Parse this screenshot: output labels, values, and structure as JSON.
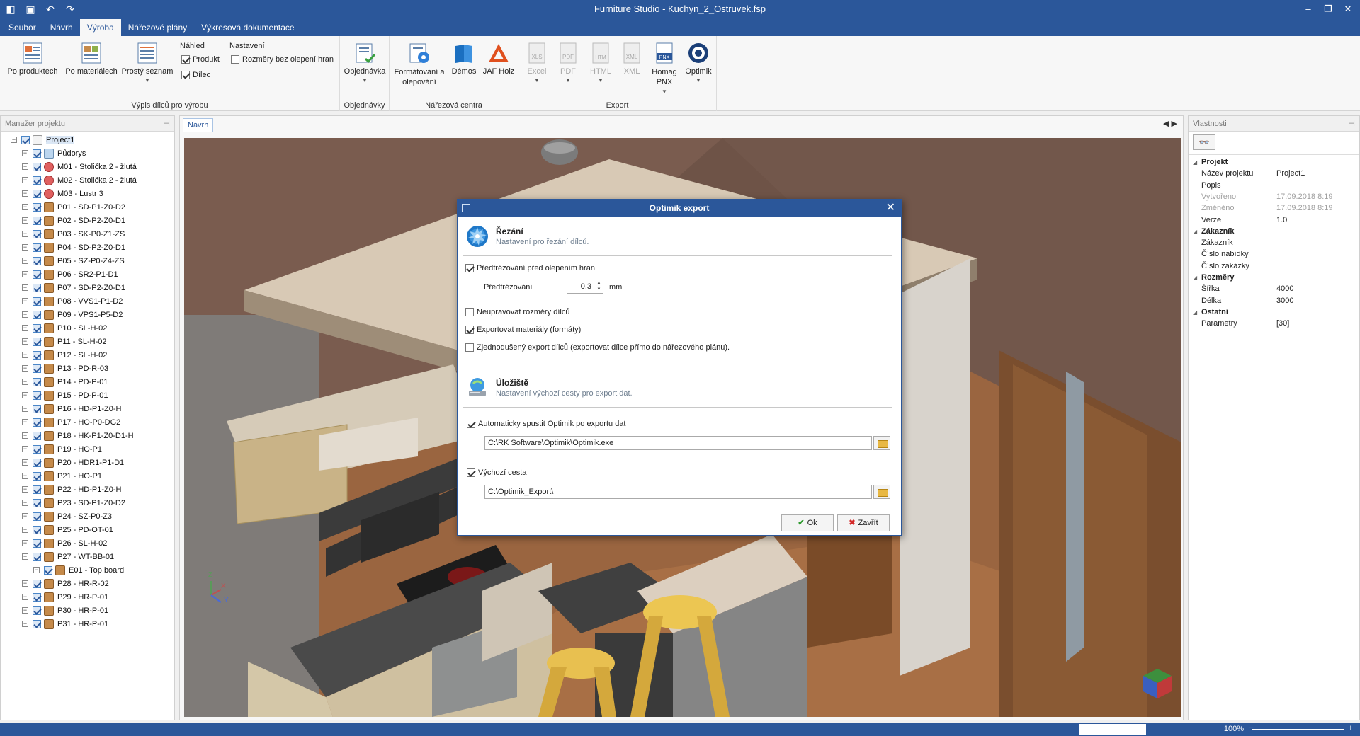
{
  "window": {
    "title": "Furniture Studio - Kuchyn_2_Ostruvek.fsp"
  },
  "menu": [
    "Soubor",
    "Návrh",
    "Výroba",
    "Nářezové plány",
    "Výkresová dokumentace"
  ],
  "ribbon": {
    "vypis": {
      "by_product": "Po produktech",
      "by_material": "Po materiálech",
      "simple_list": "Prostý seznam",
      "preview_header": "Náhled",
      "preview_product": "Produkt",
      "preview_part": "Dílec",
      "settings_header": "Nastavení",
      "settings_dims": "Rozměry bez olepení hran",
      "group_label": "Výpis dílců pro výrobu"
    },
    "orders": {
      "button": "Objednávka",
      "group_label": "Objednávky"
    },
    "cutting": {
      "format": "Formátování a olepování",
      "demos": "Démos",
      "jaf": "JAF Holz",
      "group_label": "Nářezová centra"
    },
    "export": {
      "excel": "Excel",
      "pdf": "PDF",
      "html": "HTML",
      "xml": "XML",
      "homag": "Homag PNX",
      "optimik": "Optimik",
      "group_label": "Export"
    }
  },
  "left_panel": {
    "title": "Manažer projektu",
    "tree": [
      {
        "label": "Project1",
        "level": 0,
        "icon": "proj"
      },
      {
        "label": "Půdorys",
        "level": 1,
        "icon": "plan"
      },
      {
        "label": "M01 - Stolička 2 - žlutá",
        "level": 1,
        "icon": "model"
      },
      {
        "label": "M02 - Stolička 2 - žlutá",
        "level": 1,
        "icon": "model"
      },
      {
        "label": "M03 - Lustr 3",
        "level": 1,
        "icon": "model"
      },
      {
        "label": "P01 - SD-P1-Z0-D2",
        "level": 1,
        "icon": "board"
      },
      {
        "label": "P02 - SD-P2-Z0-D1",
        "level": 1,
        "icon": "board"
      },
      {
        "label": "P03 - SK-P0-Z1-ZS",
        "level": 1,
        "icon": "board"
      },
      {
        "label": "P04 - SD-P2-Z0-D1",
        "level": 1,
        "icon": "board"
      },
      {
        "label": "P05 - SZ-P0-Z4-ZS",
        "level": 1,
        "icon": "board"
      },
      {
        "label": "P06 - SR2-P1-D1",
        "level": 1,
        "icon": "board"
      },
      {
        "label": "P07 - SD-P2-Z0-D1",
        "level": 1,
        "icon": "board"
      },
      {
        "label": "P08 - VVS1-P1-D2",
        "level": 1,
        "icon": "board"
      },
      {
        "label": "P09 - VPS1-P5-D2",
        "level": 1,
        "icon": "board"
      },
      {
        "label": "P10 - SL-H-02",
        "level": 1,
        "icon": "board"
      },
      {
        "label": "P11 - SL-H-02",
        "level": 1,
        "icon": "board"
      },
      {
        "label": "P12 - SL-H-02",
        "level": 1,
        "icon": "board"
      },
      {
        "label": "P13 - PD-R-03",
        "level": 1,
        "icon": "board"
      },
      {
        "label": "P14 - PD-P-01",
        "level": 1,
        "icon": "board"
      },
      {
        "label": "P15 - PD-P-01",
        "level": 1,
        "icon": "board"
      },
      {
        "label": "P16 - HD-P1-Z0-H",
        "level": 1,
        "icon": "board"
      },
      {
        "label": "P17 - HO-P0-DG2",
        "level": 1,
        "icon": "board"
      },
      {
        "label": "P18 - HK-P1-Z0-D1-H",
        "level": 1,
        "icon": "board"
      },
      {
        "label": "P19 - HO-P1",
        "level": 1,
        "icon": "board"
      },
      {
        "label": "P20 - HDR1-P1-D1",
        "level": 1,
        "icon": "board"
      },
      {
        "label": "P21 - HO-P1",
        "level": 1,
        "icon": "board"
      },
      {
        "label": "P22 - HD-P1-Z0-H",
        "level": 1,
        "icon": "board"
      },
      {
        "label": "P23 - SD-P1-Z0-D2",
        "level": 1,
        "icon": "board"
      },
      {
        "label": "P24 - SZ-P0-Z3",
        "level": 1,
        "icon": "board"
      },
      {
        "label": "P25 - PD-OT-01",
        "level": 1,
        "icon": "board"
      },
      {
        "label": "P26 - SL-H-02",
        "level": 1,
        "icon": "board"
      },
      {
        "label": "P27 - WT-BB-01",
        "level": 1,
        "icon": "board"
      },
      {
        "label": "E01 - Top board",
        "level": 2,
        "icon": "board"
      },
      {
        "label": "P28 - HR-R-02",
        "level": 1,
        "icon": "board"
      },
      {
        "label": "P29 - HR-P-01",
        "level": 1,
        "icon": "board"
      },
      {
        "label": "P30 - HR-P-01",
        "level": 1,
        "icon": "board"
      },
      {
        "label": "P31 - HR-P-01",
        "level": 1,
        "icon": "board"
      }
    ]
  },
  "viewport": {
    "tab": "Návrh",
    "axes": {
      "z": "Z",
      "x": "X",
      "y": "Y"
    }
  },
  "right_panel": {
    "title": "Vlastnosti",
    "tool_icon": "glasses-icon",
    "rows": [
      {
        "k": "Projekt",
        "v": "",
        "cat": true
      },
      {
        "k": "Název projektu",
        "v": "Project1"
      },
      {
        "k": "Popis",
        "v": ""
      },
      {
        "k": "Vytvořeno",
        "v": "17.09.2018 8:19",
        "ro": true
      },
      {
        "k": "Změněno",
        "v": "17.09.2018 8:19",
        "ro": true
      },
      {
        "k": "Verze",
        "v": "1.0"
      },
      {
        "k": "Zákazník",
        "v": "",
        "cat": true
      },
      {
        "k": "Zákazník",
        "v": ""
      },
      {
        "k": "Číslo nabídky",
        "v": ""
      },
      {
        "k": "Číslo zakázky",
        "v": ""
      },
      {
        "k": "Rozměry",
        "v": "",
        "cat": true
      },
      {
        "k": "Šířka",
        "v": "4000"
      },
      {
        "k": "Délka",
        "v": "3000"
      },
      {
        "k": "Ostatní",
        "v": "",
        "cat": true
      },
      {
        "k": "Parametry",
        "v": "[30]"
      }
    ]
  },
  "status": {
    "zoom": "100%",
    "minus": "−",
    "plus": "+"
  },
  "dialog": {
    "title": "Optimik export",
    "cutting": {
      "title": "Řezání",
      "desc": "Nastavení pro řezání dílců.",
      "prefrez_check": "Předfrézování před olepením hran",
      "prefrez_label": "Předfrézování",
      "prefrez_value": "0.3",
      "prefrez_unit": "mm",
      "no_dims": "Neupravovat rozměry dílců",
      "export_mat": "Exportovat materiály (formáty)",
      "simple_export": "Zjednodušený export dílců (exportovat dílce přímo do nářezového plánu)."
    },
    "storage": {
      "title": "Úložiště",
      "desc": "Nastavení výchozí cesty pro export dat.",
      "auto_run": "Automaticky spustit Optimik po exportu dat",
      "exe_path": "C:\\RK Software\\Optimik\\Optimik.exe",
      "default_path_check": "Výchozí cesta",
      "default_path": "C:\\Optimik_Export\\"
    },
    "ok": "Ok",
    "close": "Zavřít"
  }
}
